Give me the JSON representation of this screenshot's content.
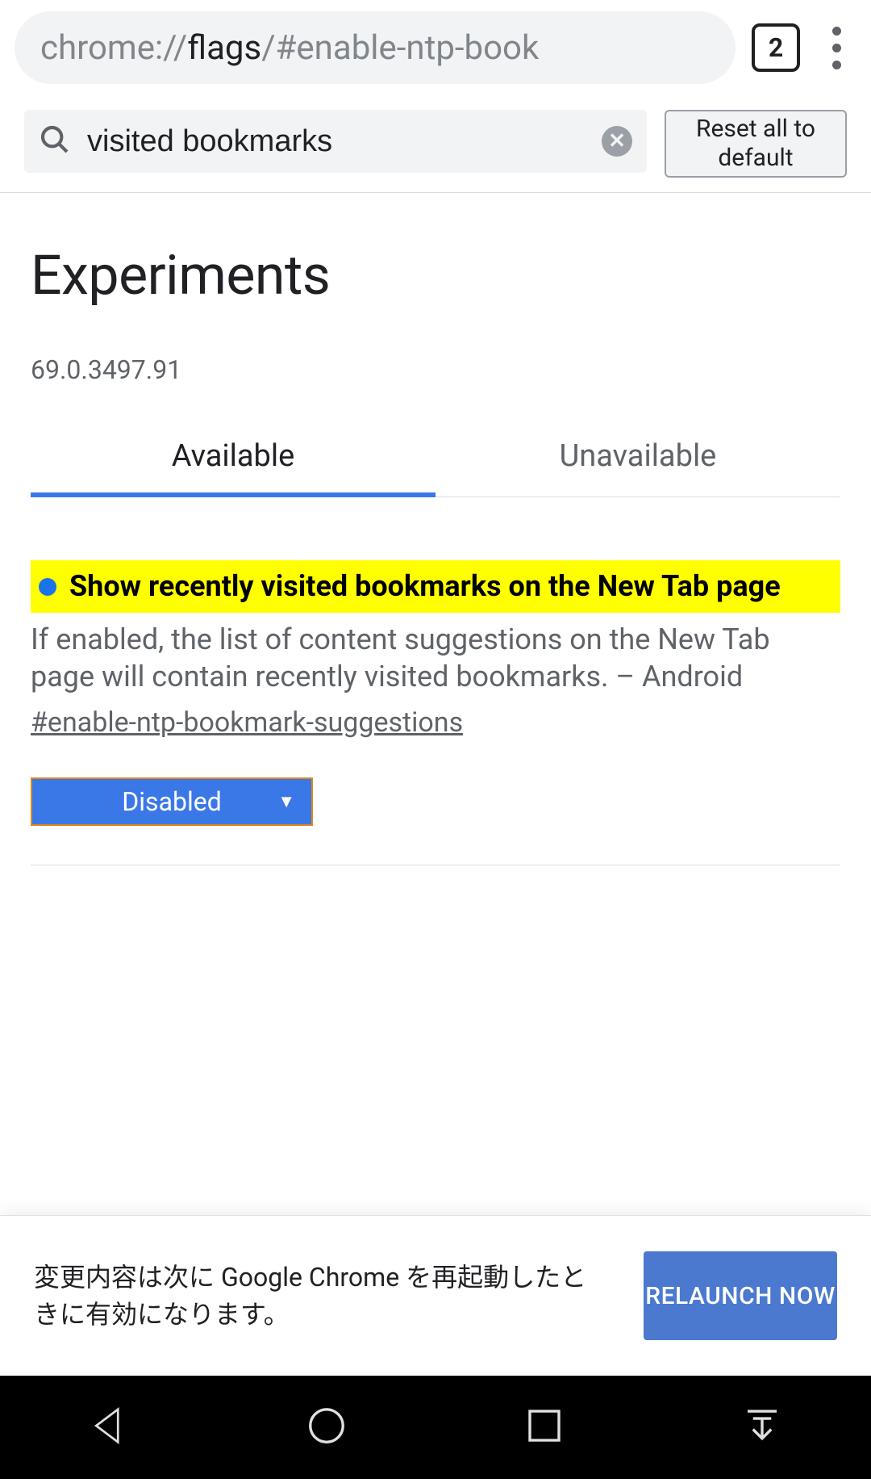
{
  "browser": {
    "url_protocol": "chrome://",
    "url_host": "flags",
    "url_path": "/#enable-ntp-book",
    "tab_count": "2"
  },
  "toolbar": {
    "search_value": "visited bookmarks",
    "reset_label": "Reset all to default"
  },
  "page": {
    "title": "Experiments",
    "version": "69.0.3497.91"
  },
  "tabs": {
    "available": "Available",
    "unavailable": "Unavailable"
  },
  "flag": {
    "title": "Show recently visited bookmarks on the New Tab page",
    "description": "If enabled, the list of content suggestions on the New Tab page will contain recently visited bookmarks. – Android",
    "id": "#enable-ntp-bookmark-suggestions",
    "selected": "Disabled"
  },
  "banner": {
    "text": "変更内容は次に Google Chrome を再起動したときに有効になります。",
    "relaunch": "RELAUNCH NOW"
  }
}
